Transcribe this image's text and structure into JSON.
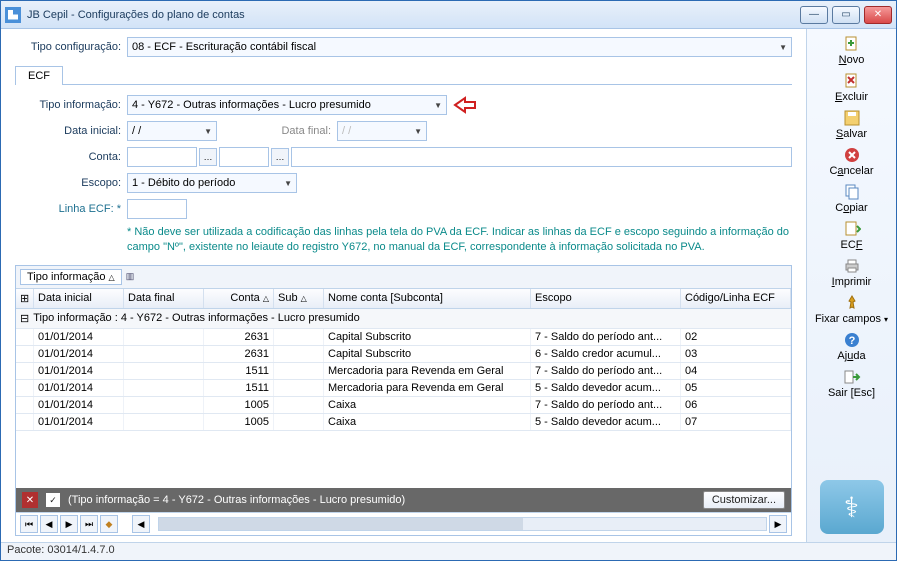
{
  "window": {
    "title": "JB Cepil - Configurações do plano de contas"
  },
  "toolbar": {
    "novo": "Novo",
    "excluir": "Excluir",
    "salvar": "Salvar",
    "cancelar": "Cancelar",
    "copiar": "Copiar",
    "ecf": "ECF",
    "imprimir": "Imprimir",
    "fixar": "Fixar campos",
    "ajuda": "Ajuda",
    "sair": "Sair [Esc]"
  },
  "form": {
    "tipo_config_label": "Tipo configuração:",
    "tipo_config_value": "08 - ECF - Escrituração contábil fiscal",
    "tab": "ECF",
    "tipo_info_label": "Tipo informação:",
    "tipo_info_value": "4 - Y672 - Outras informações - Lucro presumido",
    "data_inicial_label": "Data inicial:",
    "data_inicial_value": "/  /",
    "data_final_label": "Data final:",
    "data_final_value": "/  /",
    "conta_label": "Conta:",
    "escopo_label": "Escopo:",
    "escopo_value": "1 - Débito do período",
    "linha_label": "Linha ECF:",
    "note": "* Não deve ser utilizada a codificação das linhas pela tela do PVA da ECF. Indicar as linhas da ECF e escopo seguindo a informação do campo \"Nº\", existente no leiaute do registro Y672, no manual da ECF, correspondente à informação solicitada no PVA."
  },
  "grid": {
    "group_chip": "Tipo informação",
    "cols": {
      "data_inicial": "Data inicial",
      "data_final": "Data final",
      "conta": "Conta",
      "sub": "Sub",
      "nome": "Nome conta [Subconta]",
      "escopo": "Escopo",
      "linha": "Código/Linha ECF"
    },
    "group_row": "Tipo informação : 4 - Y672 - Outras informações - Lucro presumido",
    "rows": [
      {
        "di": "01/01/2014",
        "df": "",
        "conta": "2631",
        "sub": "",
        "nome": "Capital Subscrito",
        "escopo": "7 - Saldo do período ant...",
        "linha": "02"
      },
      {
        "di": "01/01/2014",
        "df": "",
        "conta": "2631",
        "sub": "",
        "nome": "Capital Subscrito",
        "escopo": "6 - Saldo credor acumul...",
        "linha": "03"
      },
      {
        "di": "01/01/2014",
        "df": "",
        "conta": "1511",
        "sub": "",
        "nome": "Mercadoria para Revenda em Geral",
        "escopo": "7 - Saldo do período ant...",
        "linha": "04"
      },
      {
        "di": "01/01/2014",
        "df": "",
        "conta": "1511",
        "sub": "",
        "nome": "Mercadoria para Revenda em Geral",
        "escopo": "5 - Saldo devedor acum...",
        "linha": "05"
      },
      {
        "di": "01/01/2014",
        "df": "",
        "conta": "1005",
        "sub": "",
        "nome": "Caixa",
        "escopo": "7 - Saldo do período ant...",
        "linha": "06"
      },
      {
        "di": "01/01/2014",
        "df": "",
        "conta": "1005",
        "sub": "",
        "nome": "Caixa",
        "escopo": "5 - Saldo devedor acum...",
        "linha": "07"
      }
    ],
    "filter_text": "(Tipo informação = 4 - Y672 - Outras informações - Lucro presumido)",
    "customize": "Customizar..."
  },
  "footer": {
    "pacote": "Pacote: 03014/1.4.7.0"
  }
}
